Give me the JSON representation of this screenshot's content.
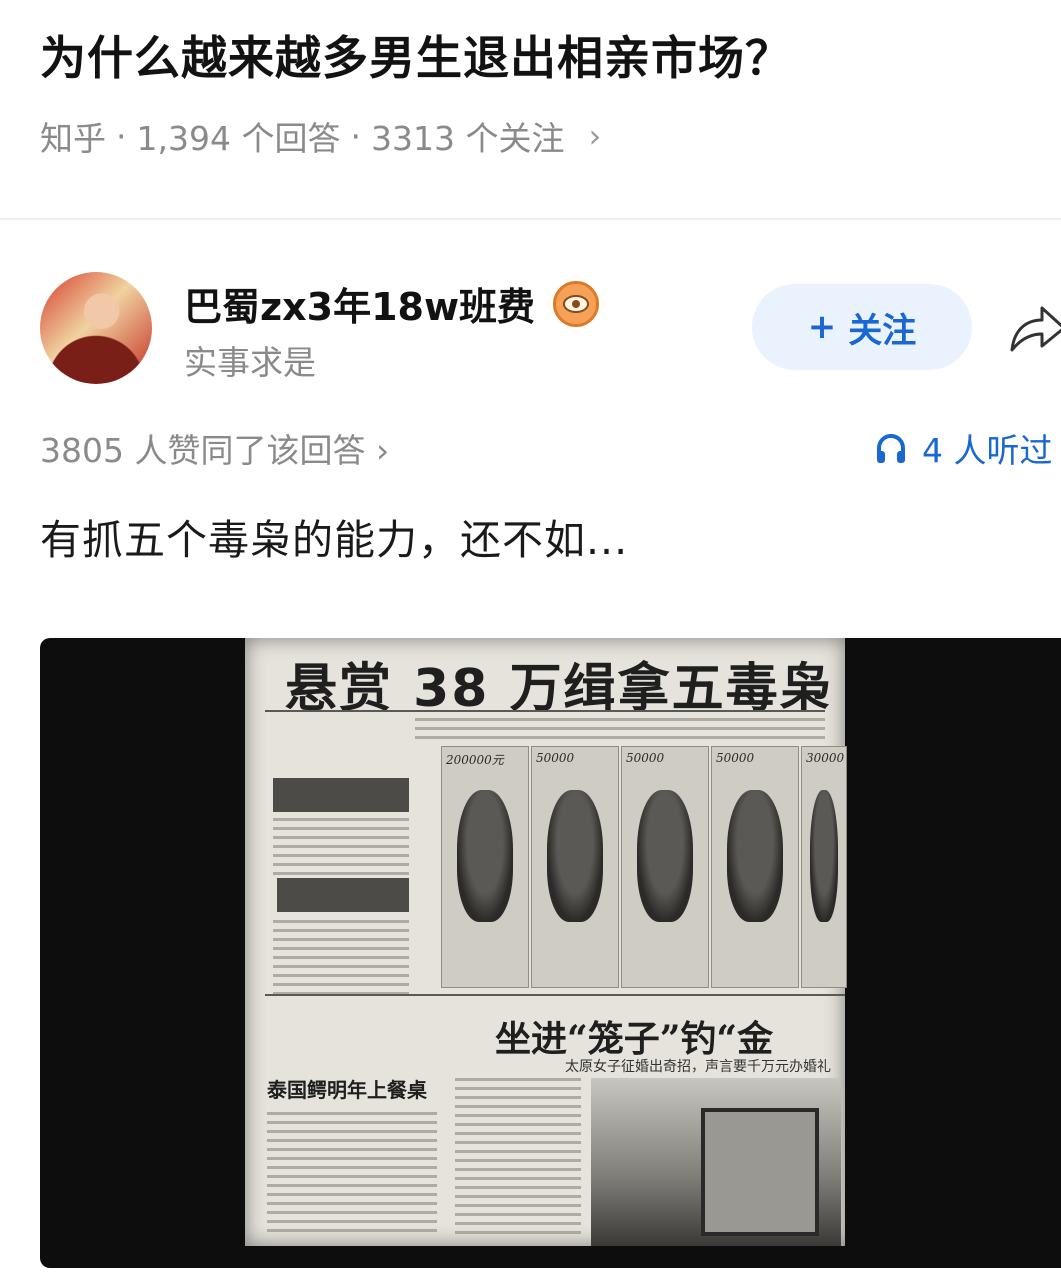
{
  "question": {
    "title": "为什么越来越多男生退出相亲市场？",
    "source": "知乎",
    "answers": "1,394 个回答",
    "followers": "3313 个关注",
    "dot": "·",
    "chevron": "›"
  },
  "author": {
    "name": "巴蜀zx3年18w班费",
    "bio": "实事求是",
    "badge_icon": "eye-badge-icon"
  },
  "follow_button": {
    "plus": "+",
    "label": "关注"
  },
  "stats": {
    "votes": "3805 人赞同了该回答 ›",
    "listen": "4 人听过"
  },
  "answer_text": "有抓五个毒枭的能力，还不如...",
  "media": {
    "headline": "悬赏 38 万缉拿五毒枭",
    "rewards": [
      "200000元",
      "50000",
      "50000",
      "50000",
      "30000"
    ],
    "sub_headline": "坐进“笼子”钓“金",
    "sub_caption": "太原女子征婚出奇招，声言要千万元办婚礼",
    "left_headline": "泰国鳄明年上餐桌"
  },
  "colors": {
    "accent_blue": "#1967d2",
    "follow_bg": "#eaf2fd",
    "meta_gray": "#8a8a8a"
  }
}
